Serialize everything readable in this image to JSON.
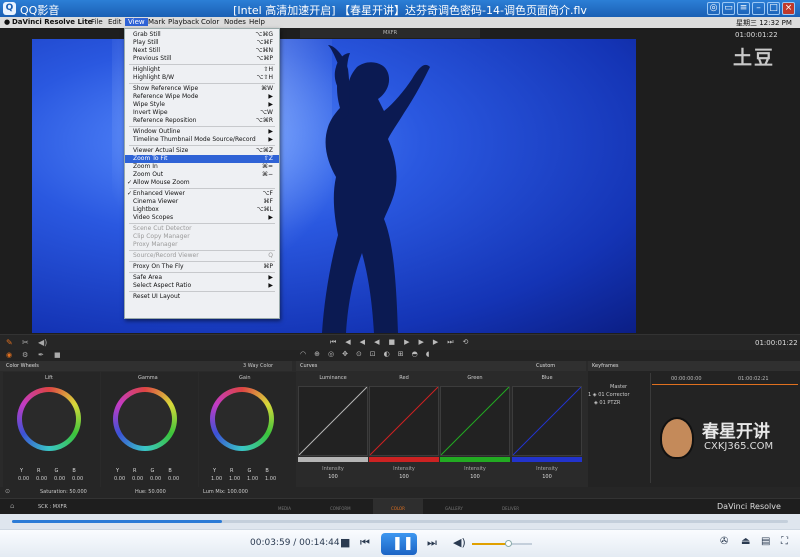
{
  "qq": {
    "app": "QQ影音",
    "title": "[Intel 高清加速开启] 【春星开讲】达芬奇调色密码-14-调色页面简介.flv",
    "logo": "Q"
  },
  "mac": {
    "apple": "",
    "app": "DaVinci Resolve Lite",
    "menus": [
      "File",
      "Edit",
      "View",
      "Mark",
      "Playback",
      "Color",
      "Nodes",
      "Help"
    ],
    "active": "View",
    "clock": "星期三 12:32 PM"
  },
  "viewer": {
    "source_label": "MXFR",
    "timecode_top": "01:00:01:22",
    "watermark": "土豆",
    "timecode_mid": "01:00:01:22"
  },
  "menu": [
    {
      "label": "Grab Still",
      "sc": "⌥⌘G"
    },
    {
      "label": "Play Still",
      "sc": "⌥⌘F"
    },
    {
      "label": "Next Still",
      "sc": "⌥⌘N"
    },
    {
      "label": "Previous Still",
      "sc": "⌥⌘P"
    },
    {
      "sep": true
    },
    {
      "label": "Highlight",
      "sc": "⇧H"
    },
    {
      "label": "Highlight B/W",
      "sc": "⌥⇧H"
    },
    {
      "sep": true
    },
    {
      "label": "Show Reference Wipe",
      "sc": "⌘W"
    },
    {
      "label": "Reference Wipe Mode",
      "sub": true
    },
    {
      "label": "Wipe Style",
      "sub": true
    },
    {
      "label": "Invert Wipe",
      "sc": "⌥W"
    },
    {
      "label": "Reference Reposition",
      "sc": "⌥⌘R"
    },
    {
      "sep": true
    },
    {
      "label": "Window Outline",
      "sub": true
    },
    {
      "label": "Timeline Thumbnail Mode Source/Record",
      "sub": true
    },
    {
      "sep": true
    },
    {
      "label": "Viewer Actual Size",
      "sc": "⌥⌘Z"
    },
    {
      "label": "Zoom To Fit",
      "sc": "⇧Z",
      "hl": true
    },
    {
      "label": "Zoom In",
      "sc": "⌘="
    },
    {
      "label": "Zoom Out",
      "sc": "⌘−"
    },
    {
      "label": "Allow Mouse Zoom",
      "check": true
    },
    {
      "sep": true
    },
    {
      "label": "Enhanced Viewer",
      "sc": "⌥F",
      "check": true
    },
    {
      "label": "Cinema Viewer",
      "sc": "⌘F"
    },
    {
      "label": "Lightbox",
      "sc": "⌥⌘L"
    },
    {
      "label": "Video Scopes",
      "sub": true
    },
    {
      "sep": true
    },
    {
      "label": "Scene Cut Detector",
      "dis": true
    },
    {
      "label": "Clip Copy Manager",
      "dis": true
    },
    {
      "label": "Proxy Manager",
      "dis": true
    },
    {
      "sep": true
    },
    {
      "label": "Source/Record Viewer",
      "sc": "Q",
      "dis": true
    },
    {
      "sep": true
    },
    {
      "label": "Proxy On The Fly",
      "sc": "⌘P"
    },
    {
      "sep": true
    },
    {
      "label": "Safe Area",
      "sub": true
    },
    {
      "label": "Select Aspect Ratio",
      "sub": true
    },
    {
      "sep": true
    },
    {
      "label": "Reset UI Layout"
    }
  ],
  "color": {
    "wheels_title": "Color Wheels",
    "wheel_mode": "3 Way Color",
    "wheels": [
      {
        "name": "Lift",
        "y": "0.00",
        "r": "0.00",
        "g": "0.00",
        "b": "0.00"
      },
      {
        "name": "Gamma",
        "y": "0.00",
        "r": "0.00",
        "g": "0.00",
        "b": "0.00"
      },
      {
        "name": "Gain",
        "y": "1.00",
        "r": "1.00",
        "g": "1.00",
        "b": "1.00"
      }
    ],
    "rgb_letters": [
      "Y",
      "R",
      "G",
      "B"
    ],
    "saturation": "Saturation: 50.000",
    "hue": "Hue: 50.000",
    "lum": "Lum Mix: 100.000",
    "curves_title": "Curves",
    "curves_mode": "Custom",
    "curves": [
      {
        "name": "Luminance",
        "color": "#b5b5b5"
      },
      {
        "name": "Red",
        "color": "#c22"
      },
      {
        "name": "Green",
        "color": "#2a2"
      },
      {
        "name": "Blue",
        "color": "#23c"
      }
    ],
    "intensity_label": "Intensity",
    "intensity_value": "100",
    "kf_title": "Keyframes",
    "kf_t1": "00:00:00:00",
    "kf_t2": "01:00:02:21",
    "kf_rows": [
      "Master",
      "1  ◈ 01 Corrector",
      "  ◈ 01 PTZR"
    ]
  },
  "navtabs": [
    "MEDIA",
    "CONFORM",
    "COLOR",
    "GALLERY",
    "DELIVER"
  ],
  "resolve_brand": "DaVinci Resolve",
  "status_left": "SCK : MXFR",
  "player": {
    "time": "00:03:59 / 00:14:44",
    "progress": 0.27,
    "volume": 0.6
  },
  "brand_wm": {
    "cn": "春星开讲",
    "en": "CXKJ365.COM"
  },
  "colors": {
    "qqblue": "#1a5fb4",
    "accent": "#e0701f"
  }
}
